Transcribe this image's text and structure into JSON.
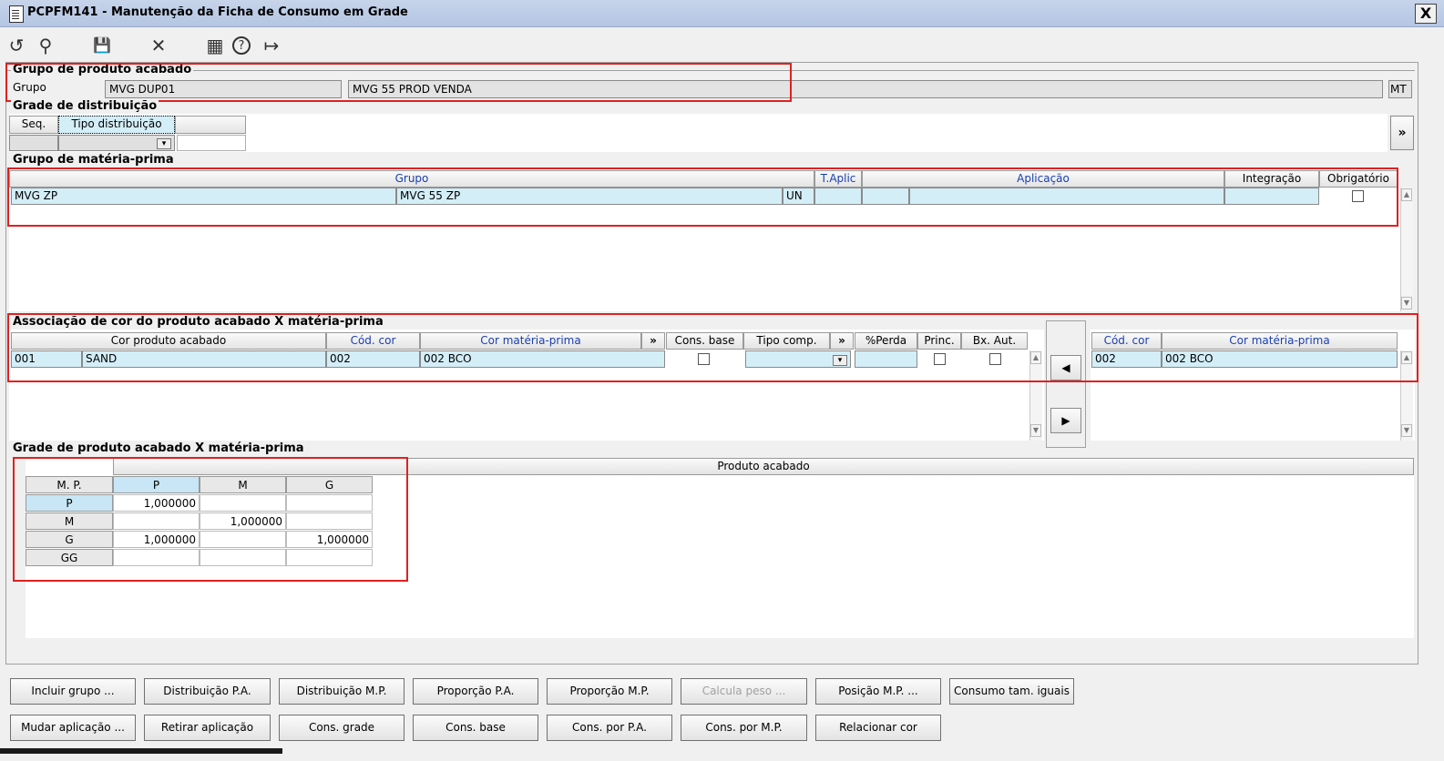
{
  "window": {
    "title": "PCPFM141 - Manutenção da Ficha de Consumo em Grade",
    "close_label": "X"
  },
  "toolbar": {
    "undo_icon": "↺",
    "search_icon": "⚲",
    "save_icon": "💾",
    "cancel_icon": "✕",
    "calendar_icon": "▦",
    "help_icon": "?",
    "exit_icon": "↦"
  },
  "grupo_pa": {
    "legend": "Grupo de produto acabado",
    "label": "Grupo",
    "code": "MVG DUP01",
    "description": "MVG 55 PROD VENDA",
    "unit": "MT"
  },
  "grade_dist": {
    "legend": "Grade de distribuição",
    "col_seq": "Seq.",
    "col_tipo": "Tipo distribuição",
    "more_label": "»"
  },
  "grupo_mp": {
    "legend": "Grupo de matéria-prima",
    "headers": {
      "grupo": "Grupo",
      "taplic": "T.Aplic",
      "aplicacao": "Aplicação",
      "integracao": "Integração",
      "obrigatorio": "Obrigatório"
    },
    "row": {
      "code": "MVG ZP",
      "description": "MVG 55 ZP",
      "unit": "UN"
    }
  },
  "assoc": {
    "legend": "Associação de cor do produto acabado X matéria-prima",
    "headers": {
      "cor_pa": "Cor produto acabado",
      "cod_cor": "Cód. cor",
      "cor_mp": "Cor matéria-prima",
      "more1": "»",
      "cons_base": "Cons. base",
      "tipo_comp": "Tipo comp.",
      "more2": "»",
      "perda": "%Perda",
      "princ": "Princ.",
      "bx_aut": "Bx. Aut."
    },
    "row": {
      "cor_code": "001",
      "cor_name": "SAND",
      "cod_cor": "002",
      "cor_mp": "002 BCO"
    },
    "right_headers": {
      "cod_cor": "Cód. cor",
      "cor_mp": "Cor matéria-prima"
    },
    "right_row": {
      "cod_cor": "002",
      "cor_mp": "002 BCO"
    },
    "move_left": "◀",
    "move_right": "▶"
  },
  "grade": {
    "legend": "Grade de produto acabado X matéria-prima",
    "header_pa": "Produto acabado",
    "corner": "M. P.",
    "columns": [
      "P",
      "M",
      "G"
    ],
    "rows": [
      {
        "label": "P",
        "values": [
          "1,000000",
          "",
          ""
        ]
      },
      {
        "label": "M",
        "values": [
          "",
          "1,000000",
          ""
        ]
      },
      {
        "label": "G",
        "values": [
          "1,000000",
          "",
          "1,000000"
        ]
      },
      {
        "label": "GG",
        "values": [
          "",
          "",
          ""
        ]
      }
    ]
  },
  "buttons_row1": [
    "Incluir grupo ...",
    "Distribuição P.A.",
    "Distribuição M.P.",
    "Proporção P.A.",
    "Proporção M.P.",
    "Calcula peso ...",
    "Posição M.P. ...",
    "Consumo tam. iguais"
  ],
  "buttons_row2": [
    "Mudar aplicação ...",
    "Retirar aplicação",
    "Cons. grade",
    "Cons. base",
    "Cons. por P.A.",
    "Cons. por M.P.",
    "Relacionar cor"
  ]
}
